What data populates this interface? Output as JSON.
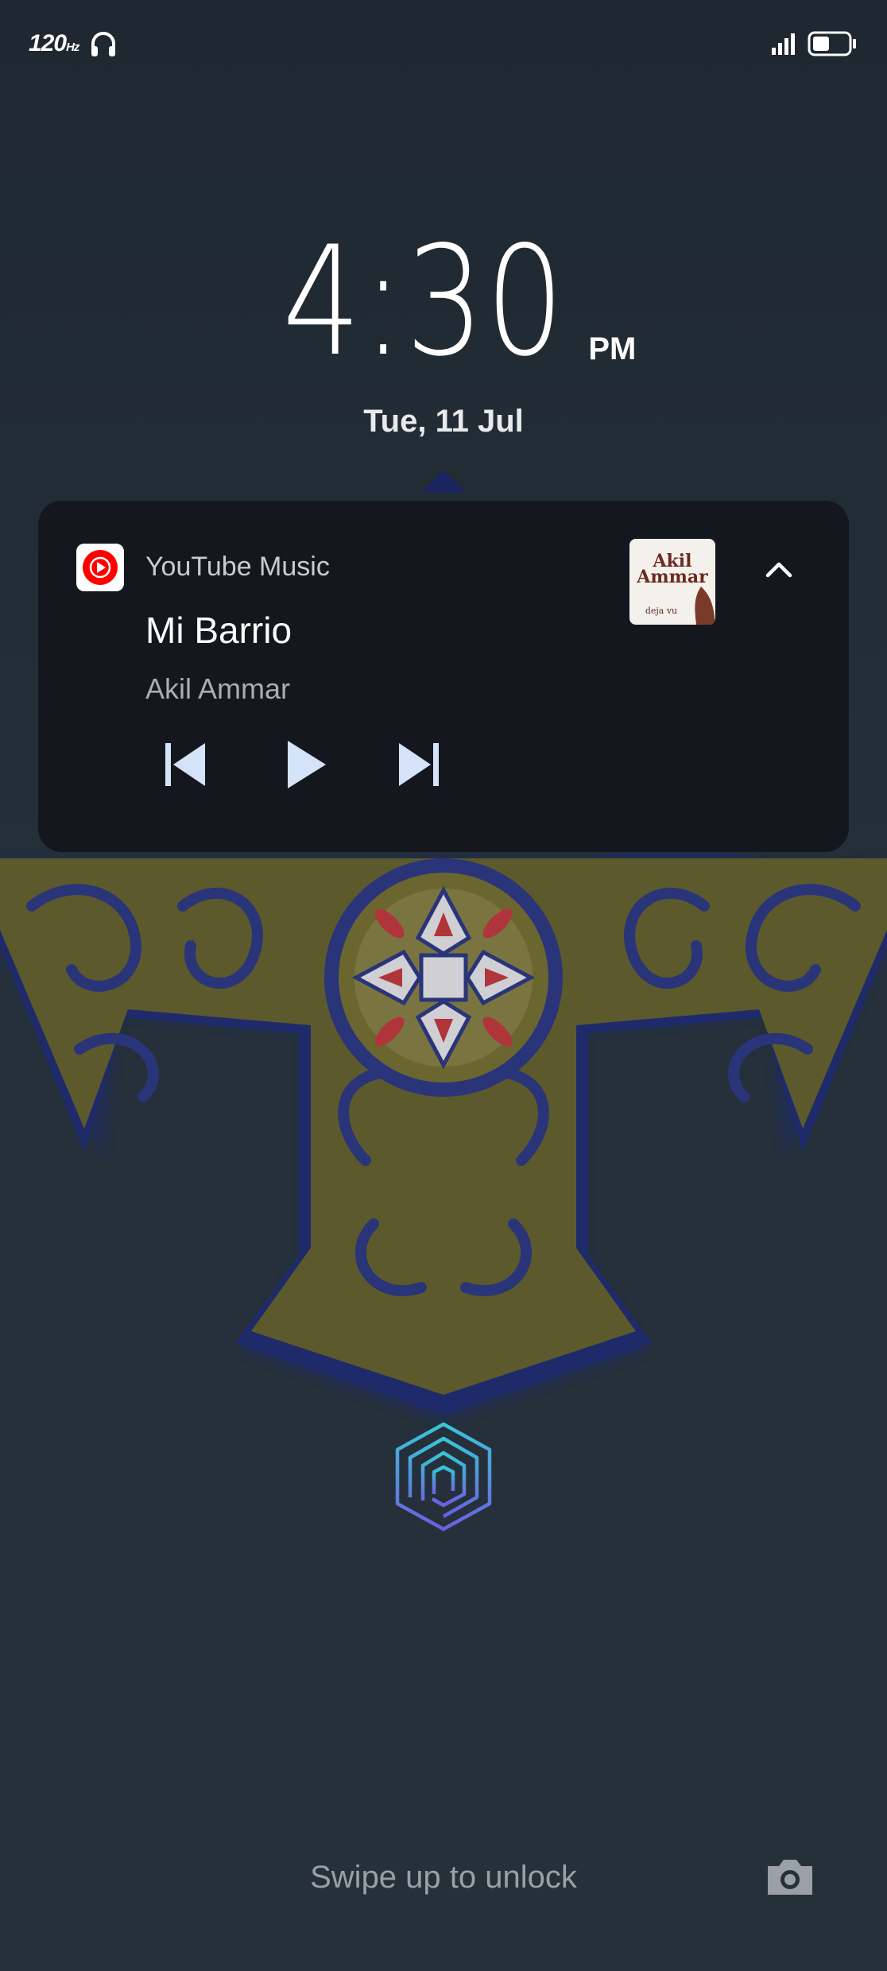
{
  "status_bar": {
    "refresh_rate_value": "120",
    "refresh_rate_unit": "Hz",
    "icons": [
      "headphones-icon",
      "signal-icon",
      "battery-icon"
    ]
  },
  "clock": {
    "time": "4:30",
    "ampm": "PM",
    "date": "Tue, 11 Jul"
  },
  "media": {
    "app_name": "YouTube Music",
    "track_title": "Mi Barrio",
    "artist": "Akil Ammar",
    "album_art_title": "Akil Ammar",
    "album_art_subtitle": "deja vu",
    "state": "paused",
    "controls": [
      "previous-icon",
      "play-icon",
      "next-icon"
    ]
  },
  "lockscreen": {
    "unlock_hint": "Swipe up to unlock",
    "shortcut": "camera-icon"
  },
  "colors": {
    "background": "#25303a",
    "card": "#14171e",
    "control_tint": "#d4e3f7",
    "youtube_red": "#ff0000"
  }
}
